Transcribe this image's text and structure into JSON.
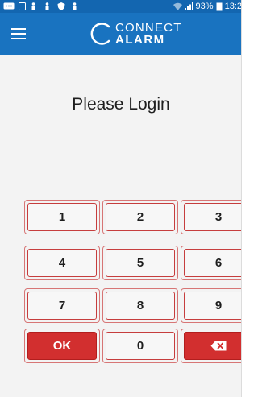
{
  "status_bar": {
    "battery_percent": "93%",
    "time": "13:2"
  },
  "app_bar": {
    "logo_line1": "CONNECT",
    "logo_line2": "ALARM"
  },
  "login": {
    "title": "Please Login"
  },
  "keypad": {
    "rows": [
      [
        "1",
        "2",
        "3"
      ],
      [
        "4",
        "5",
        "6"
      ],
      [
        "7",
        "8",
        "9"
      ],
      [
        "OK",
        "0",
        "backspace-icon"
      ]
    ]
  },
  "colors": {
    "app_bar": "#1973c0",
    "status_bar": "#1366b0",
    "key_border": "#c63d3d",
    "ok_button": "#d22f2f"
  }
}
